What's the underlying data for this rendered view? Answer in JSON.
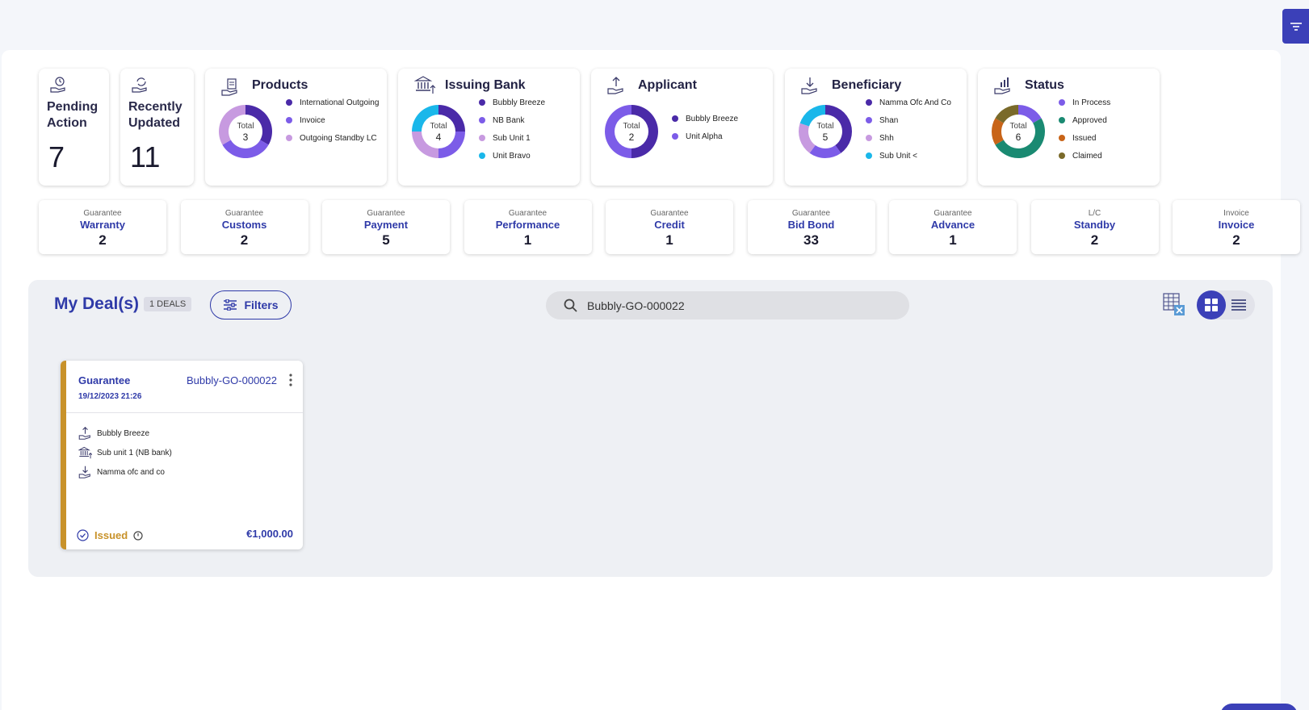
{
  "summary": {
    "pending": {
      "title_line1": "Pending",
      "title_line2": "Action",
      "value": "7"
    },
    "recent": {
      "title_line1": "Recently",
      "title_line2": "Updated",
      "value": "11"
    }
  },
  "charts": {
    "products": {
      "title": "Products",
      "total_label": "Total",
      "total": "3",
      "legend": [
        "International Outgoing",
        "Invoice",
        "Outgoing Standby LC"
      ]
    },
    "issuing_bank": {
      "title": "Issuing Bank",
      "total_label": "Total",
      "total": "4",
      "legend": [
        "Bubbly Breeze",
        "NB Bank",
        "Sub Unit 1",
        "Unit Bravo"
      ]
    },
    "applicant": {
      "title": "Applicant",
      "total_label": "Total",
      "total": "2",
      "legend": [
        "Bubbly Breeze",
        "Unit Alpha"
      ]
    },
    "beneficiary": {
      "title": "Beneficiary",
      "total_label": "Total",
      "total": "5",
      "legend": [
        "Namma Ofc And Co",
        "Shan",
        "Shh",
        "Sub Unit <"
      ]
    },
    "status": {
      "title": "Status",
      "total_label": "Total",
      "total": "6",
      "legend": [
        "In Process",
        "Approved",
        "Issued",
        "Claimed"
      ]
    }
  },
  "products": [
    {
      "category": "Guarantee",
      "name": "Warranty",
      "count": "2"
    },
    {
      "category": "Guarantee",
      "name": "Customs",
      "count": "2"
    },
    {
      "category": "Guarantee",
      "name": "Payment",
      "count": "5"
    },
    {
      "category": "Guarantee",
      "name": "Performance",
      "count": "1"
    },
    {
      "category": "Guarantee",
      "name": "Credit",
      "count": "1"
    },
    {
      "category": "Guarantee",
      "name": "Bid Bond",
      "count": "33"
    },
    {
      "category": "Guarantee",
      "name": "Advance",
      "count": "1"
    },
    {
      "category": "L/C",
      "name": "Standby",
      "count": "2"
    },
    {
      "category": "Invoice",
      "name": "Invoice",
      "count": "2"
    }
  ],
  "deals": {
    "title": "My Deal(s)",
    "badge": "1 DEALS",
    "filters_label": "Filters",
    "search_value": "Bubbly-GO-000022"
  },
  "deal_card": {
    "type": "Guarantee",
    "reference": "Bubbly-GO-000022",
    "date": "19/12/2023 21:26",
    "applicant": "Bubbly Breeze",
    "issuing_bank": "Sub unit 1 (NB bank)",
    "beneficiary": "Namma ofc and co",
    "status": "Issued",
    "amount": "€1,000.00"
  },
  "colors": {
    "primary": "#2f3aa8",
    "button": "#3b40b8",
    "issued": "#c8922a",
    "purple_dark": "#4a2aa8",
    "purple_mid": "#7c5ce8",
    "purple_light": "#c79ae0",
    "cyan": "#1ab7ea",
    "teal": "#1a8a72",
    "black": "#111111",
    "orange": "#c86418",
    "olive": "#7a6a2a"
  },
  "chart_data": [
    {
      "type": "pie",
      "title": "Products",
      "categories": [
        "International Outgoing",
        "Invoice",
        "Outgoing Standby LC"
      ],
      "values": [
        1,
        1,
        1
      ],
      "colors": [
        "#4a2aa8",
        "#7c5ce8",
        "#c79ae0"
      ]
    },
    {
      "type": "pie",
      "title": "Issuing Bank",
      "categories": [
        "Bubbly Breeze",
        "NB Bank",
        "Sub Unit 1",
        "Unit Bravo"
      ],
      "values": [
        1,
        1,
        1,
        1
      ],
      "colors": [
        "#4a2aa8",
        "#7c5ce8",
        "#c79ae0",
        "#1ab7ea"
      ]
    },
    {
      "type": "pie",
      "title": "Applicant",
      "categories": [
        "Bubbly Breeze",
        "Unit Alpha"
      ],
      "values": [
        1,
        1
      ],
      "colors": [
        "#4a2aa8",
        "#7c5ce8"
      ]
    },
    {
      "type": "pie",
      "title": "Beneficiary",
      "categories": [
        "Namma Ofc And Co",
        "Shan",
        "Shh",
        "Sub Unit <"
      ],
      "values": [
        2,
        1,
        1,
        1
      ],
      "colors": [
        "#4a2aa8",
        "#7c5ce8",
        "#c79ae0",
        "#1ab7ea"
      ]
    },
    {
      "type": "pie",
      "title": "Status",
      "categories": [
        "In Process",
        "Approved",
        "Issued",
        "Claimed"
      ],
      "values": [
        1,
        3,
        1,
        1
      ],
      "colors": [
        "#7c5ce8",
        "#1a8a72",
        "#c86418",
        "#7a6a2a"
      ]
    }
  ]
}
